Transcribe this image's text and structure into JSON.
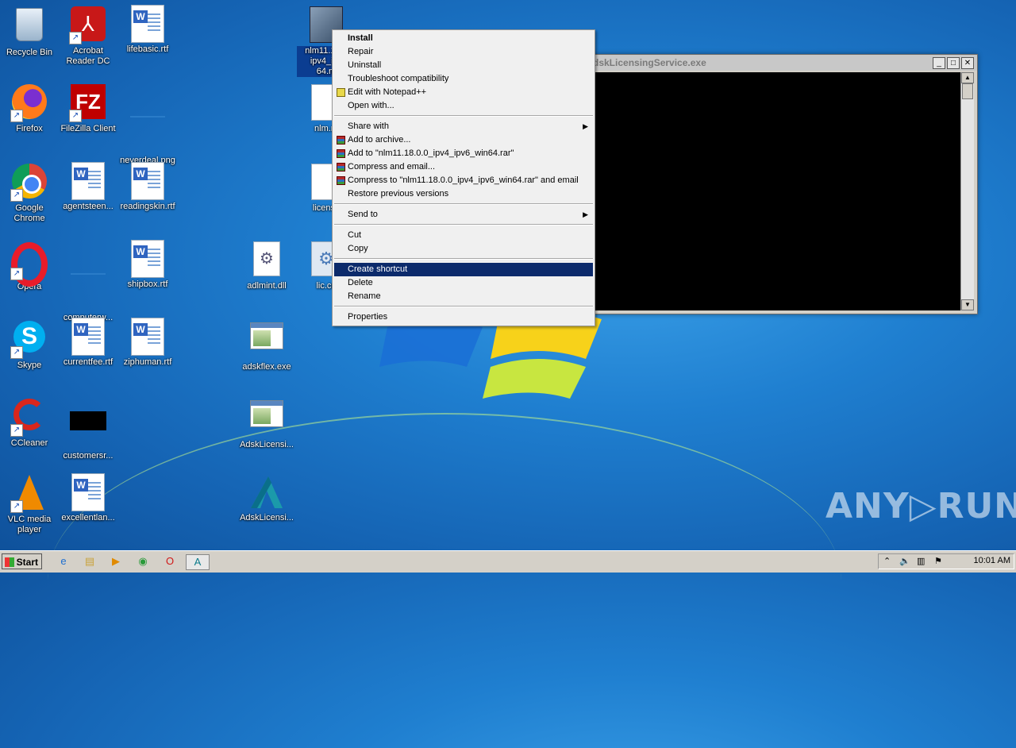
{
  "desktop": {
    "icons": [
      {
        "label": "Recycle Bin"
      },
      {
        "label": "Acrobat Reader DC"
      },
      {
        "label": "lifebasic.rtf"
      },
      {
        "label": "Firefox"
      },
      {
        "label": "FileZilla Client"
      },
      {
        "label": "neverdeal.png"
      },
      {
        "label": "Google Chrome"
      },
      {
        "label": "agentsteen..."
      },
      {
        "label": "readingskin.rtf"
      },
      {
        "label": "Opera"
      },
      {
        "label": "computerw..."
      },
      {
        "label": "shipbox.rtf"
      },
      {
        "label": "Skype"
      },
      {
        "label": "currentfee.rtf"
      },
      {
        "label": "ziphuman.rtf"
      },
      {
        "label": "CCleaner"
      },
      {
        "label": "customersr..."
      },
      {
        "label": "VLC media player"
      },
      {
        "label": "excellentlan..."
      },
      {
        "label": "nlm11.18.0.0_ipv4_ipv6_win64.msi",
        "display": "nlm11.18...\nipv4_ipv\n64.m"
      },
      {
        "label": "nlm.m"
      },
      {
        "label": "license"
      },
      {
        "label": "adlmint.dll"
      },
      {
        "label": "lic.cn"
      },
      {
        "label": "adskflex.exe"
      },
      {
        "label": "AdskLicensi..."
      },
      {
        "label": "AdskLicensi..."
      }
    ]
  },
  "console": {
    "title": "dskLicensingService.exe",
    "buttons": {
      "minimize": "_",
      "maximize": "□",
      "close": "✕"
    }
  },
  "context_menu": {
    "items": [
      {
        "label": "Install"
      },
      {
        "label": "Repair"
      },
      {
        "label": "Uninstall"
      },
      {
        "label": "Troubleshoot compatibility"
      },
      {
        "label": "Edit with Notepad++"
      },
      {
        "label": "Open with..."
      },
      {
        "label": "Share with"
      },
      {
        "label": "Add to archive..."
      },
      {
        "label": "Add to \"nlm11.18.0.0_ipv4_ipv6_win64.rar\""
      },
      {
        "label": "Compress and email..."
      },
      {
        "label": "Compress to \"nlm11.18.0.0_ipv4_ipv6_win64.rar\" and email"
      },
      {
        "label": "Restore previous versions"
      },
      {
        "label": "Send to"
      },
      {
        "label": "Cut"
      },
      {
        "label": "Copy"
      },
      {
        "label": "Create shortcut"
      },
      {
        "label": "Delete"
      },
      {
        "label": "Rename"
      },
      {
        "label": "Properties"
      }
    ]
  },
  "watermark": "ANY▷RUN",
  "taskbar": {
    "start_label": "Start",
    "clock": "10:01 AM"
  }
}
